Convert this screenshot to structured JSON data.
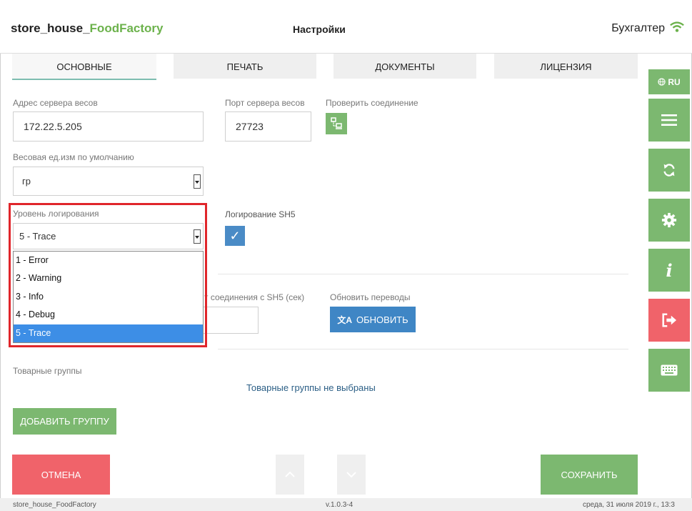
{
  "header": {
    "brand_prefix": "store_house_",
    "brand_accent": "FoodFactory",
    "title": "Настройки",
    "user": "Бухгалтер"
  },
  "tabs": [
    {
      "label": "ОСНОВНЫЕ",
      "active": true
    },
    {
      "label": "ПЕЧАТЬ",
      "active": false
    },
    {
      "label": "ДОКУМЕНТЫ",
      "active": false
    },
    {
      "label": "ЛИЦЕНЗИЯ",
      "active": false
    }
  ],
  "sidebar": {
    "lang": "RU",
    "buttons": [
      "menu-icon",
      "sync-icon",
      "gear-icon",
      "info-icon",
      "logout-icon",
      "keyboard-icon"
    ]
  },
  "form": {
    "scale_server_address_label": "Адрес сервера весов",
    "scale_server_address_value": "172.22.5.205",
    "scale_server_port_label": "Порт сервера весов",
    "scale_server_port_value": "27723",
    "check_connection_label": "Проверить соединение",
    "default_weight_unit_label": "Весовая ед.изм по умолчанию",
    "default_weight_unit_value": "гр",
    "log_level_label": "Уровень логирования",
    "log_level_value": "5 - Trace",
    "log_level_options": [
      "1 - Error",
      "2 - Warning",
      "3 - Info",
      "4 - Debug",
      "5 - Trace"
    ],
    "sh5_logging_label": "Логирование SH5",
    "sh5_connection_timeout_label": "т соединения с SH5 (сек)",
    "update_translations_label": "Обновить переводы",
    "update_button": "ОБНОВИТЬ",
    "product_groups_label": "Товарные группы",
    "product_groups_empty": "Товарные группы не выбраны",
    "add_group_button": "ДОБАВИТЬ ГРУППУ"
  },
  "actions": {
    "cancel": "ОТМЕНА",
    "save": "СОХРАНИТЬ"
  },
  "footer": {
    "app": "store_house_FoodFactory",
    "version": "v.1.0.3-4",
    "datetime": "среда, 31 июля 2019 г., 13:3"
  },
  "colors": {
    "green": "#7cb870",
    "red": "#f0636a",
    "blue": "#3f86c5",
    "highlight": "#e0262b"
  }
}
